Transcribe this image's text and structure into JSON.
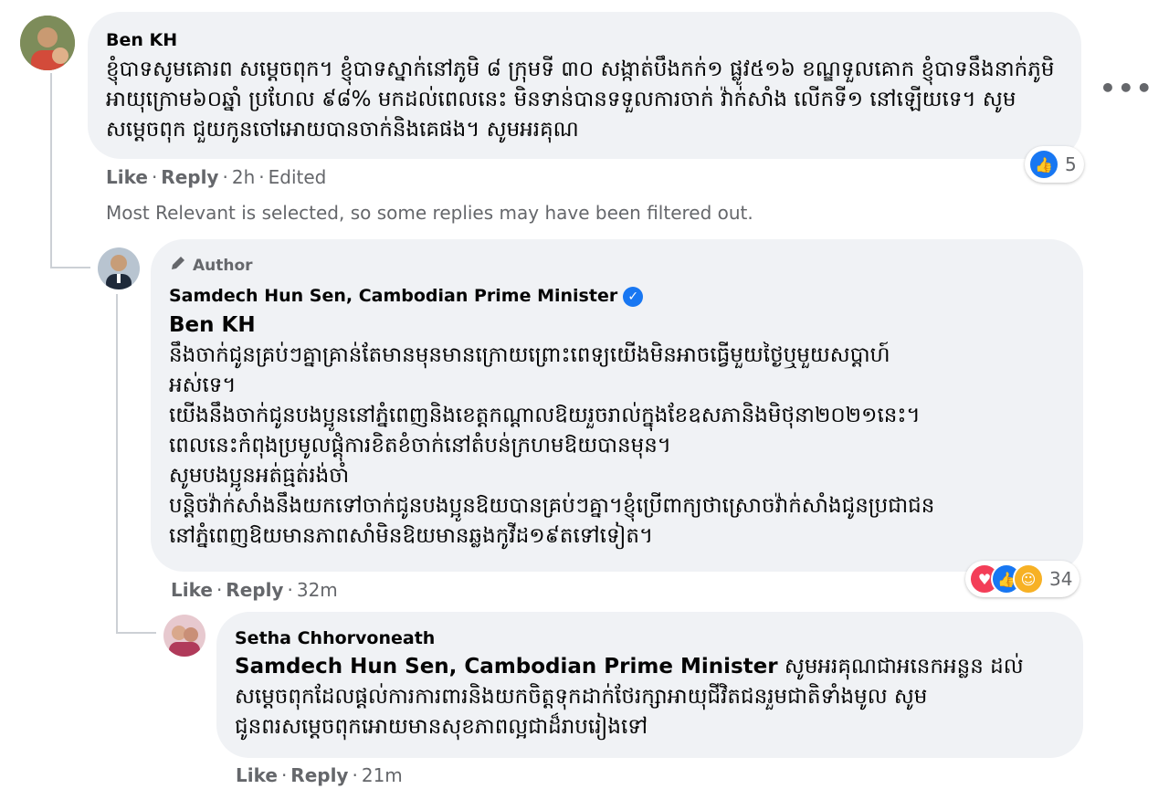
{
  "comment1": {
    "author": "Ben KH",
    "text": "ខ្ញុំបាទសូមគោរព សម្ដេចពុក។ ខ្ញុំបាទស្នាក់នៅភូមិ ៨ ក្រុមទី ៣០ សង្កាត់បឹងកក់១ ផ្លូវ៥១៦ ខណ្ឌទួលគោក ខ្ញុំបាទនឹងនាក់ភូមិអាយុក្រោម៦០ឆ្នាំ ប្រហែល ៩៨% មកដល់ពេលនេះ មិនទាន់បានទទួលការចាក់ វ៉ាក់សាំង លើកទី១ នៅឡើយទេ។ សូមសម្ដេចពុក ជួយកូនចៅអោយបានចាក់និងគេផង។ សូមអរគុណ",
    "like": "Like",
    "reply": "Reply",
    "time": "2h",
    "edited": "Edited",
    "reaction_count": "5",
    "more": "•••"
  },
  "filter_notice": "Most Relevant is selected, so some replies may have been filtered out.",
  "reply1": {
    "badge": "Author",
    "author": "Samdech Hun Sen, Cambodian Prime Minister",
    "mention": "Ben KH",
    "lines": [
      "នឹងចាក់ជូនគ្រប់ៗគ្នាគ្រាន់តែមានមុនមានក្រោយព្រោះពេទ្យយើងមិនអាចធ្វើមួយថ្ងៃឬមួយសប្ដាហ៍",
      "អស់ទេ។",
      "យើងនឹងចាក់ជូនបងប្អូននៅភ្នំពេញនិងខេត្តកណ្ដាលឱយរួចរាល់ក្នុងខែឧសភានិងមិថុនា២០២១នេះ។",
      "ពេលនេះកំពុងប្រមូលផ្ដុំការខិតខំចាក់នៅតំបន់ក្រហមឱយបានមុន។",
      "សូមបងប្អូនអត់ធ្មត់រង់ចាំ",
      "បន្តិចវ៉ាក់សាំងនឹងយកទៅចាក់ជូនបងប្អូនឱយបានគ្រប់ៗគ្នា។ខ្ញុំប្រើពាក្យថាស្រោចវ៉ាក់សាំងជូនប្រជាជន",
      "នៅភ្នំពេញឱយមានភាពសាំមិនឱយមានឆ្លងកូវីដ១៩តទៅទៀត។"
    ],
    "like": "Like",
    "reply": "Reply",
    "time": "32m",
    "reaction_count": "34"
  },
  "reply2": {
    "author": "Setha Chhorvoneath",
    "mention": "Samdech Hun Sen, Cambodian Prime Minister",
    "text_line1": " សូមអរគុណជាអនេកអន្លន ដល់",
    "text_line2": "សម្ដេចពុកដែលផ្ដល់ការការពារនិងយកចិត្តទុកដាក់ថែរក្សាអាយុជីវិតជនរួមជាតិទាំងមូល សូម",
    "text_line3": "ជូនពរសម្ដេចពុកអោយមានសុខភាពល្អជាដ៏រាបរៀងទៅ",
    "like": "Like",
    "reply": "Reply",
    "time": "21m"
  }
}
